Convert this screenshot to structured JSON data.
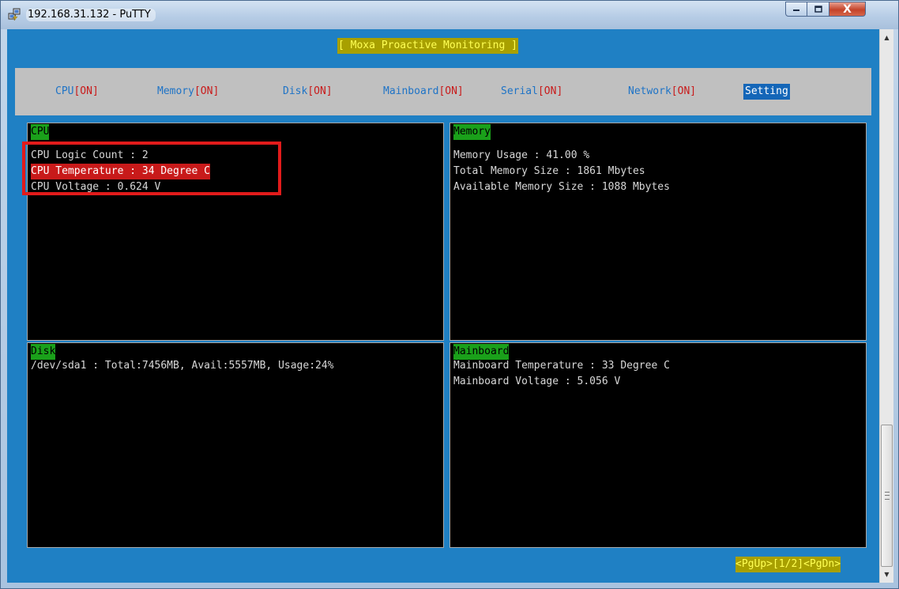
{
  "window": {
    "title": "192.168.31.132 - PuTTY",
    "icons": {
      "app": "putty-computers-icon",
      "minimize": "minimize-icon",
      "maximize": "maximize-icon",
      "close": "close-icon"
    },
    "close_glyph": "X"
  },
  "terminal": {
    "header_title": "[ Moxa Proactive Monitoring ]",
    "menu": [
      {
        "name": "CPU",
        "status": "[ON]"
      },
      {
        "name": "Memory",
        "status": "[ON]"
      },
      {
        "name": "Disk",
        "status": "[ON]"
      },
      {
        "name": "Mainboard",
        "status": "[ON]"
      },
      {
        "name": "Serial",
        "status": "[ON]"
      },
      {
        "name": "Network",
        "status": "[ON]"
      },
      {
        "name": "Setting",
        "status": ""
      }
    ],
    "panels": {
      "cpu": {
        "label": "CPU",
        "lines": [
          "CPU Logic Count : 2",
          "CPU Temperature : 34 Degree C",
          "CPU Voltage : 0.624 V"
        ]
      },
      "memory": {
        "label": "Memory",
        "lines": [
          "Memory Usage : 41.00 %",
          "Total Memory Size : 1861 Mbytes",
          "Available Memory Size : 1088 Mbytes"
        ]
      },
      "disk": {
        "label": "Disk",
        "lines": [
          "/dev/sda1 : Total:7456MB, Avail:5557MB, Usage:24%"
        ]
      },
      "mainboard": {
        "label": "Mainboard",
        "lines": [
          "Mainboard Temperature : 33 Degree C",
          "Mainboard Voltage : 5.056 V"
        ]
      }
    },
    "pager": "<PgUp>[1/2]<PgDn>"
  },
  "colors": {
    "terminal_bg": "#1f80c4",
    "menubar_bg": "#c0c0c0",
    "panel_bg": "#000000",
    "label_bg": "#1aa01a",
    "alert_bg": "#c81a1a",
    "title_bg": "#a8a000",
    "title_fg": "#ffff55",
    "annotation": "#e21b1b"
  }
}
